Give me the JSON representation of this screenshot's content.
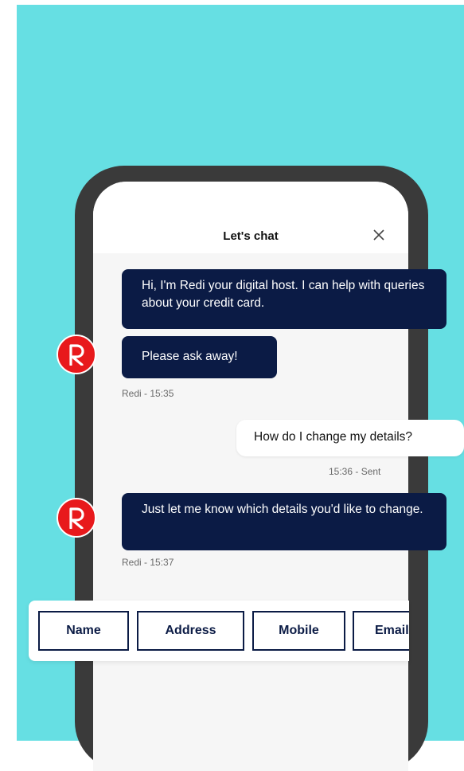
{
  "chat": {
    "title": "Let's chat",
    "close_icon": "close-icon"
  },
  "messages": [
    {
      "from": "bot",
      "text": "Hi, I'm Redi your digital host. I can help with queries about your credit card."
    },
    {
      "from": "bot",
      "text": "Please ask away!"
    },
    {
      "from": "user",
      "text": "How do I change my details?"
    },
    {
      "from": "bot",
      "text": "Just let me know which details you'd like to change."
    }
  ],
  "meta": {
    "first": "Redi - 15:35",
    "sent": "15:36 - Sent",
    "second": "Redi - 15:37"
  },
  "chips": [
    "Name",
    "Address",
    "Mobile",
    "Email"
  ],
  "colors": {
    "background": "#66dfe3",
    "bot_bubble": "#0b1b45",
    "avatar": "#e8191c",
    "phone_frame": "#3a3a3a"
  }
}
